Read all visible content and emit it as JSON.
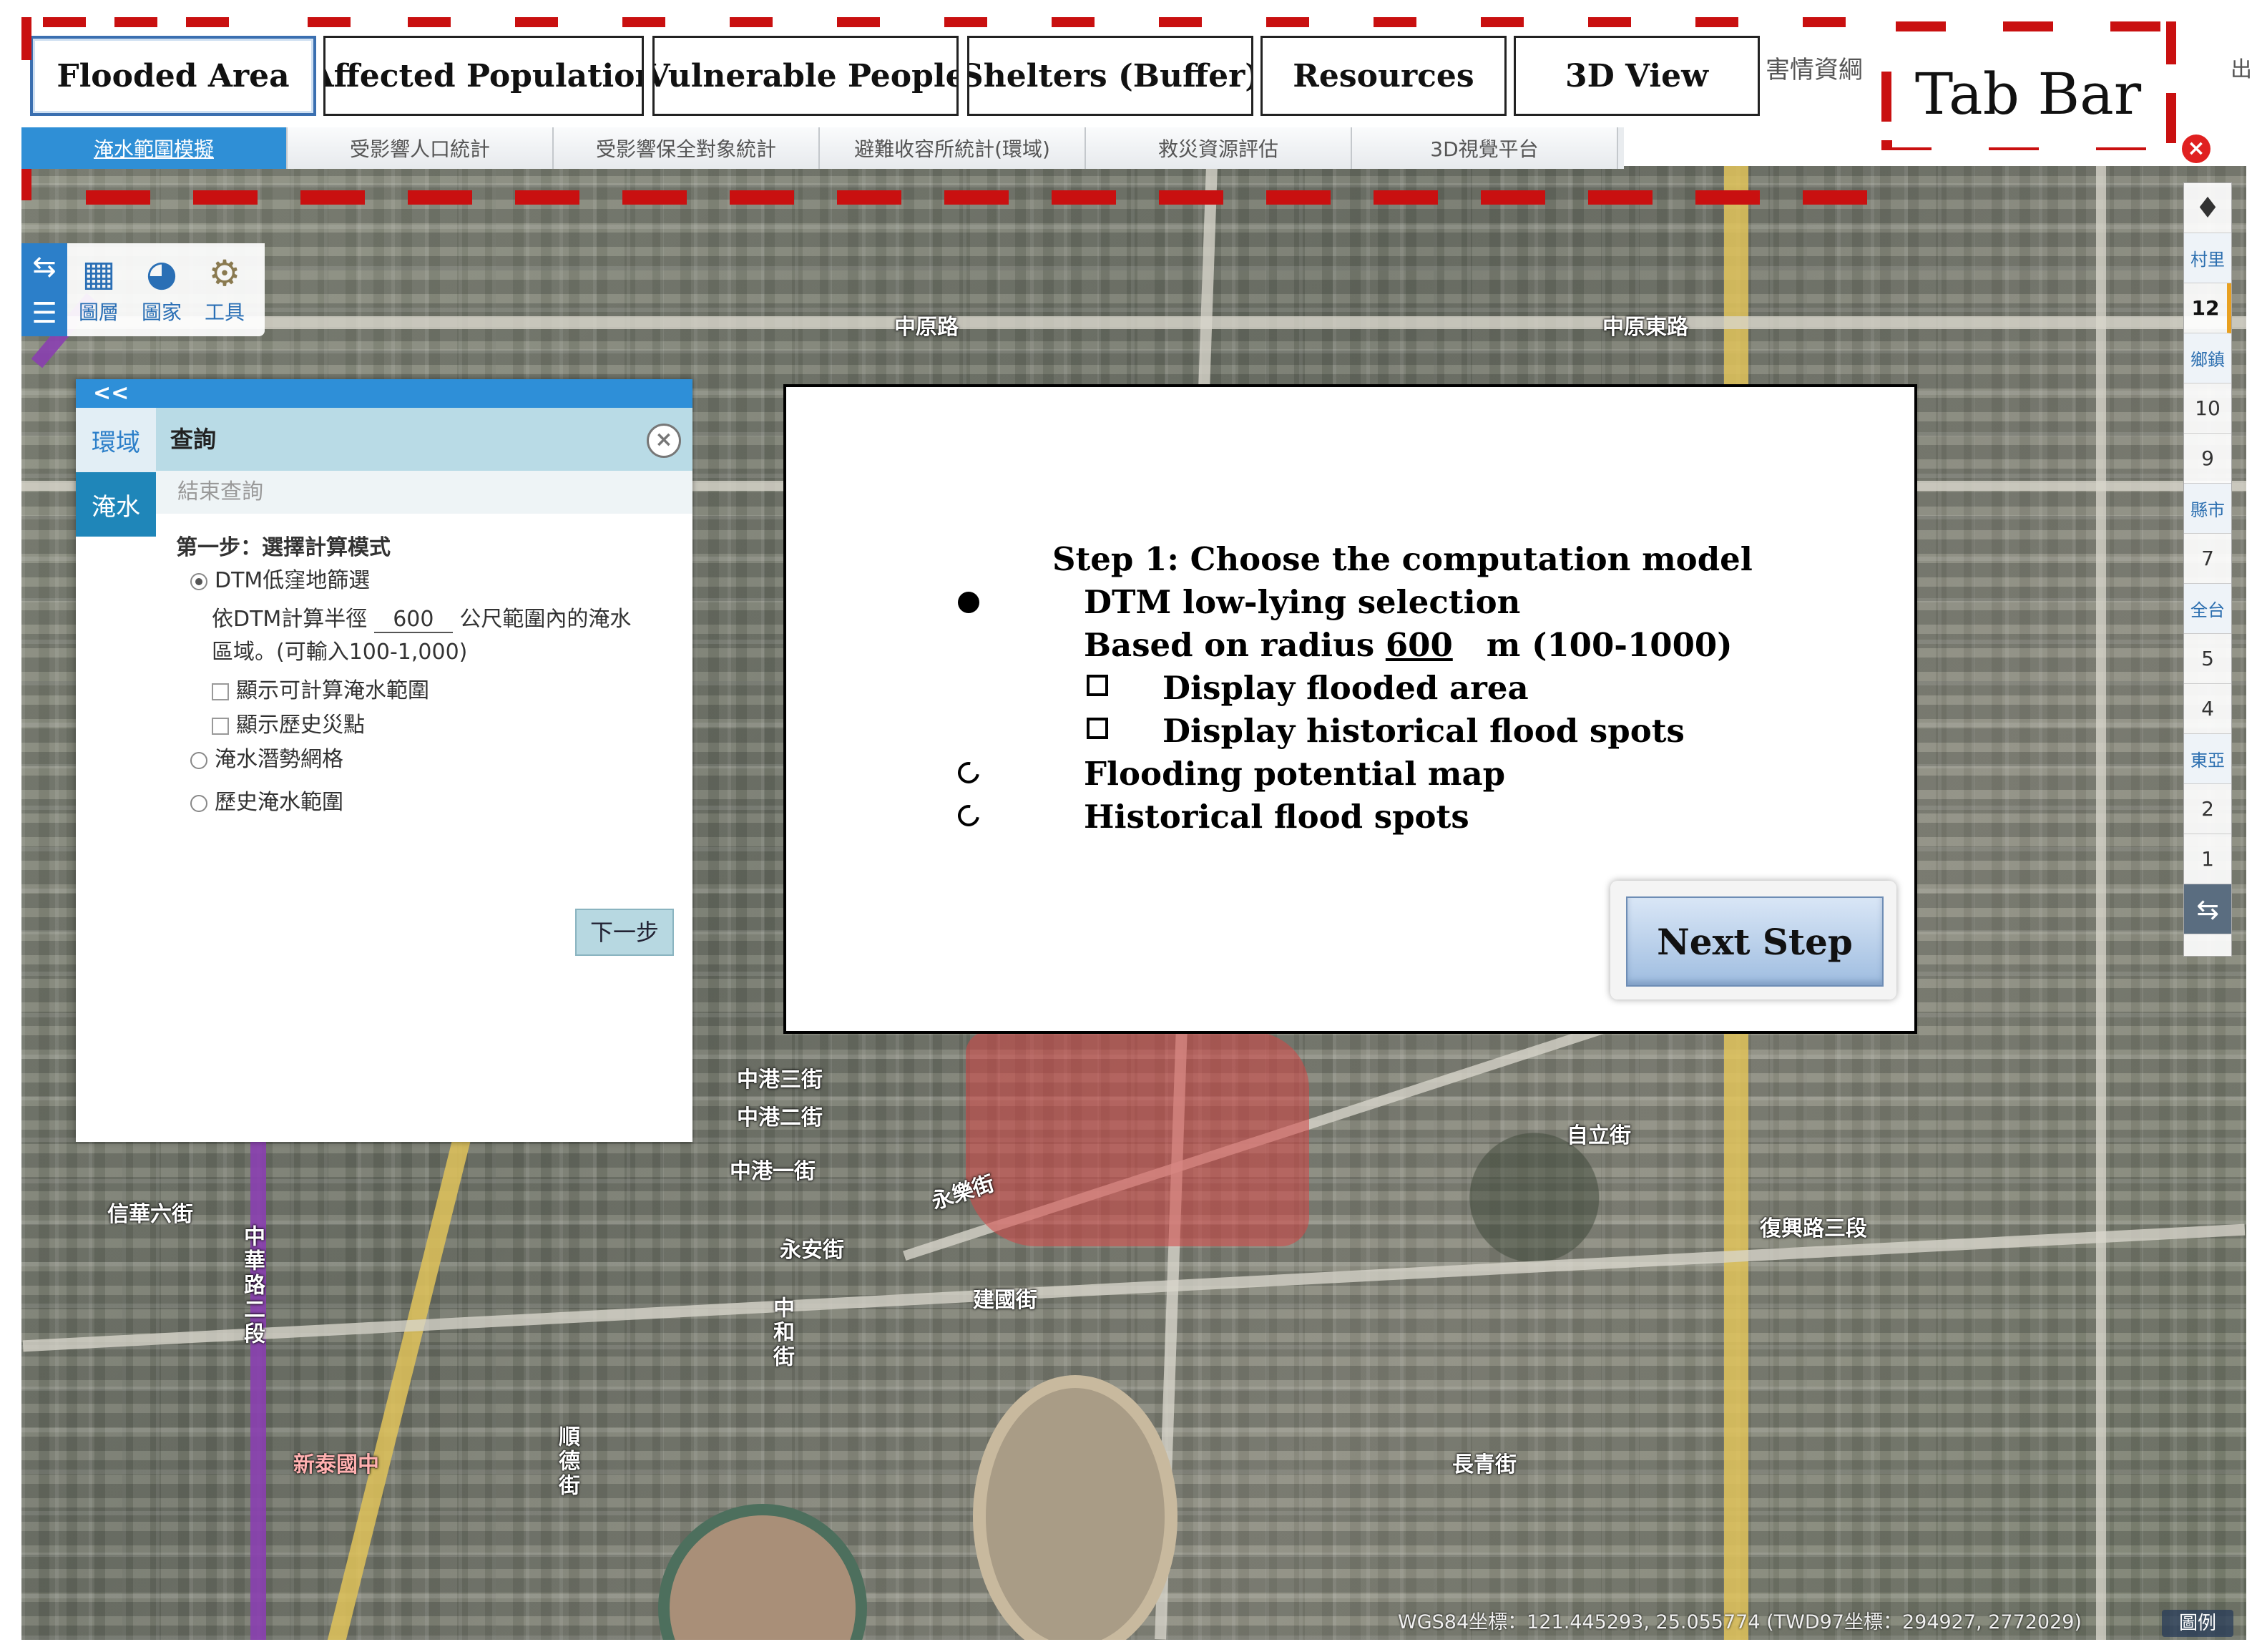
{
  "top_tabs": [
    {
      "label": "Flooded Area",
      "active": true
    },
    {
      "label": "Affected Population",
      "active": false
    },
    {
      "label": "Vulnerable People",
      "active": false
    },
    {
      "label": "Shelters (Buffer)",
      "active": false
    },
    {
      "label": "Resources",
      "active": false
    },
    {
      "label": "3D View",
      "active": false
    }
  ],
  "top_right": {
    "info_text": "害情資綱",
    "exit_text": "出"
  },
  "callout": {
    "label": "Tab Bar",
    "color": "#c91010"
  },
  "tab_strip": [
    {
      "label": "淹水範圍模擬",
      "active": true
    },
    {
      "label": "受影響人口統計",
      "active": false
    },
    {
      "label": "受影響保全對象統計",
      "active": false
    },
    {
      "label": "避難收容所統計(環域)",
      "active": false
    },
    {
      "label": "救災資源評估",
      "active": false
    },
    {
      "label": "3D視覺平台",
      "active": false
    }
  ],
  "toolbar": {
    "tools": [
      {
        "label": "圖層",
        "icon": "layers-icon"
      },
      {
        "label": "圖家",
        "icon": "palette-icon"
      },
      {
        "label": "工具",
        "icon": "gear-icon"
      }
    ]
  },
  "panel": {
    "collapse_label": "<<",
    "side_tabs": [
      "環域",
      "淹水"
    ],
    "query_label": "查詢",
    "end_query_label": "結束查詢",
    "step_title": "第一步：選擇計算模式",
    "option_dtm": "DTM低窪地篩選",
    "radius_prefix": "依DTM計算半徑",
    "radius_value": "600",
    "radius_suffix": "公尺範圍內的淹水",
    "radius_note": "區域。(可輸入100-1,000)",
    "check_flood": "顯示可計算淹水範圍",
    "check_history": "顯示歷史災點",
    "option_potential": "淹水潛勢網格",
    "option_historical": "歷史淹水範圍",
    "next_label": "下一步"
  },
  "overlay": {
    "step_title": "Step 1: Choose the computation model",
    "option_dtm": "DTM low-lying selection",
    "radius_prefix": "Based on radius",
    "radius_value": "600",
    "radius_suffix": "m (100-1000)",
    "check_flood": "Display flooded area",
    "check_history": "Display historical flood spots",
    "option_potential": "Flooding potential map",
    "option_historical": "Historical flood spots",
    "next_label": "Next Step"
  },
  "right_bar": {
    "items": [
      "村里",
      "12",
      "鄉鎮",
      "10",
      "9",
      "縣市",
      "7",
      "全台",
      "5",
      "4",
      "東亞",
      "2",
      "1"
    ],
    "selected": "12"
  },
  "map": {
    "coords_text": "WGS84坐標：121.445293, 25.055774 (TWD97坐標：294927, 2772029)",
    "legend_label": "圖例",
    "labels": [
      {
        "text": "中原路"
      },
      {
        "text": "中原東路"
      },
      {
        "text": "中港三街"
      },
      {
        "text": "中港二街"
      },
      {
        "text": "中港一街"
      },
      {
        "text": "永樂街"
      },
      {
        "text": "永安街"
      },
      {
        "text": "建國街"
      },
      {
        "text": "復興路三段"
      },
      {
        "text": "自立街"
      },
      {
        "text": "長青街"
      },
      {
        "text": "新泰國中"
      },
      {
        "text": "信華六街"
      },
      {
        "text": "中華路二段"
      },
      {
        "text": "中和街"
      },
      {
        "text": "順德街"
      }
    ]
  }
}
